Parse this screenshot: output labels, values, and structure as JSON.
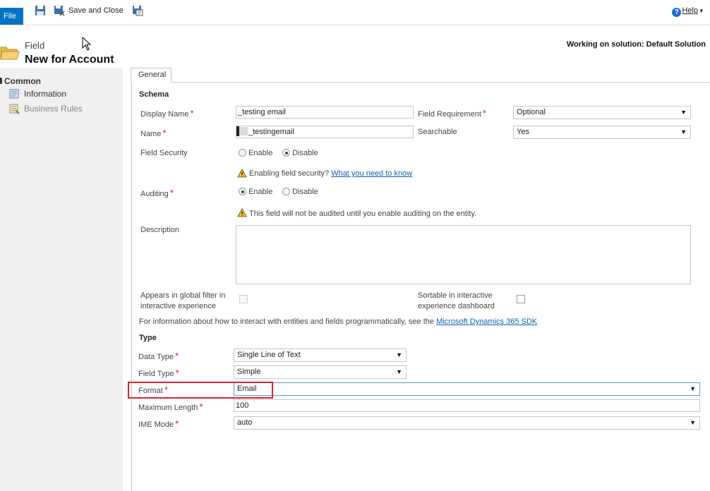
{
  "ribbon": {
    "file_label": "File",
    "save_close_label": "Save and Close",
    "help_label": "Help"
  },
  "header": {
    "entity_type": "Field",
    "title": "New for Account",
    "solution": "Working on solution: Default Solution"
  },
  "nav": {
    "section": "Common",
    "items": [
      {
        "label": "Information",
        "icon": "form-icon"
      },
      {
        "label": "Business Rules",
        "icon": "rules-icon"
      }
    ]
  },
  "tabs": [
    "General"
  ],
  "schema": {
    "title": "Schema",
    "display_name": {
      "label": "Display Name",
      "value": "_testing email"
    },
    "name": {
      "label": "Name",
      "value": "_testingemail"
    },
    "field_requirement": {
      "label": "Field Requirement",
      "value": "Optional"
    },
    "searchable": {
      "label": "Searchable",
      "value": "Yes"
    },
    "field_security": {
      "label": "Field Security",
      "options": [
        "Enable",
        "Disable"
      ],
      "selected": "Disable",
      "warning": "Enabling field security?",
      "warning_link": "What you need to know"
    },
    "auditing": {
      "label": "Auditing",
      "options": [
        "Enable",
        "Disable"
      ],
      "selected": "Enable",
      "warning": "This field will not be audited until you enable auditing on the entity."
    },
    "description": {
      "label": "Description",
      "value": ""
    },
    "global_filter": {
      "label_line1": "Appears in global filter in",
      "label_line2": "interactive experience",
      "checked": false
    },
    "sortable": {
      "label_line1": "Sortable in interactive",
      "label_line2": "experience dashboard",
      "checked": false
    },
    "sdk_text": "For information about how to interact with entities and fields programmatically, see the",
    "sdk_link": "Microsoft Dynamics 365 SDK"
  },
  "type": {
    "title": "Type",
    "data_type": {
      "label": "Data Type",
      "value": "Single Line of Text"
    },
    "field_type": {
      "label": "Field Type",
      "value": "Simple"
    },
    "format": {
      "label": "Format",
      "value": "Email"
    },
    "max_length": {
      "label": "Maximum Length",
      "value": "100"
    },
    "ime_mode": {
      "label": "IME Mode",
      "value": "auto"
    }
  },
  "colors": {
    "accent": "#0072c6",
    "required": "#e81123",
    "link": "#1160b7",
    "highlight": "#d8222a"
  }
}
